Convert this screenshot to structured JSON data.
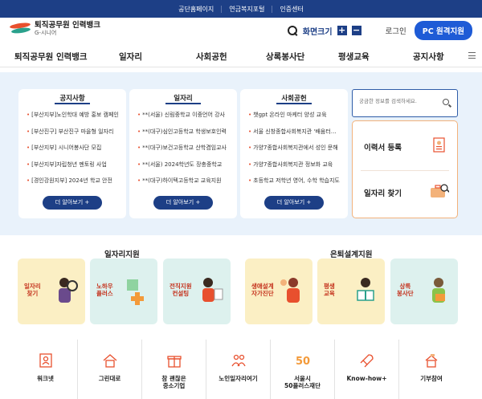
{
  "topbar": {
    "links": [
      "공단홈페이지",
      "연금복지포털",
      "인증센터"
    ]
  },
  "header": {
    "logo_title": "퇴직공무원 인력뱅크",
    "logo_sub": "G-시니어",
    "font_size_label": "화면크기",
    "plus": "+",
    "minus": "−",
    "login": "로그인",
    "pc_button": "PC 원격지원"
  },
  "nav": {
    "items": [
      "퇴직공무원 인력뱅크",
      "일자리",
      "사회공헌",
      "상록봉사단",
      "평생교육",
      "공지사항"
    ]
  },
  "cards": [
    {
      "title": "공지사항",
      "items": [
        "[부산지부]노인학대 예방 홍보 캠페인",
        "[부산진구] 부산진구 마을형 일자리",
        "[부산지부] 시니어봉사단 모집",
        "[부산지부]자립청년 멘토링 사업",
        "[경인강원지부] 2024년 학교 안전"
      ],
      "more": "더 알아보기 +"
    },
    {
      "title": "일자리",
      "items": [
        "**(서울) 신림중학교 이중언어 강사",
        "**(대구)심인고등학교 학생보호인력",
        "**(대구)보건고등학교 산학겸임교사",
        "**(서울) 2024학년도 장충중학교",
        "**(대구)하이텍고등학교 교육지원"
      ],
      "more": "더 알아보기 +"
    },
    {
      "title": "사회공헌",
      "items": [
        "챗gpt 온라인 마케터 양성 교육",
        "서울 신창종합사회복지관 '배움터지킴이'",
        "가양7종합사회복지관에서 성인 문해",
        "가양7종합사회복지관 정보화 교육",
        "초등학교 저학년 영어, 수학 학습지도"
      ],
      "more": "더 알아보기 +"
    }
  ],
  "search": {
    "placeholder": "궁금한 정보를 검색하세요."
  },
  "quick": {
    "resume": "이력서 등록",
    "find_job": "일자리 찾기"
  },
  "sections": {
    "left_title": "일자리지원",
    "right_title": "은퇴설계지원",
    "left_tiles": [
      "일자리\n찾기",
      "노하우\n플러스",
      "전직지원\n컨설팅"
    ],
    "right_tiles": [
      "생애설계\n자가진단",
      "평생\n교육",
      "상록\n봉사단"
    ]
  },
  "bottom": {
    "items": [
      "워크넷",
      "그린대로",
      "참 괜찮은\n중소기업",
      "노인일자리여기",
      "서울시\n50플러스재단",
      "Know-how+",
      "기부참여"
    ]
  },
  "colors": {
    "navy": "#1d3f86",
    "accent_orange": "#e8502e",
    "tile_yellow": "#fbefc4",
    "tile_mint": "#ddf1ee",
    "hero_bg": "#e9f2fb"
  }
}
